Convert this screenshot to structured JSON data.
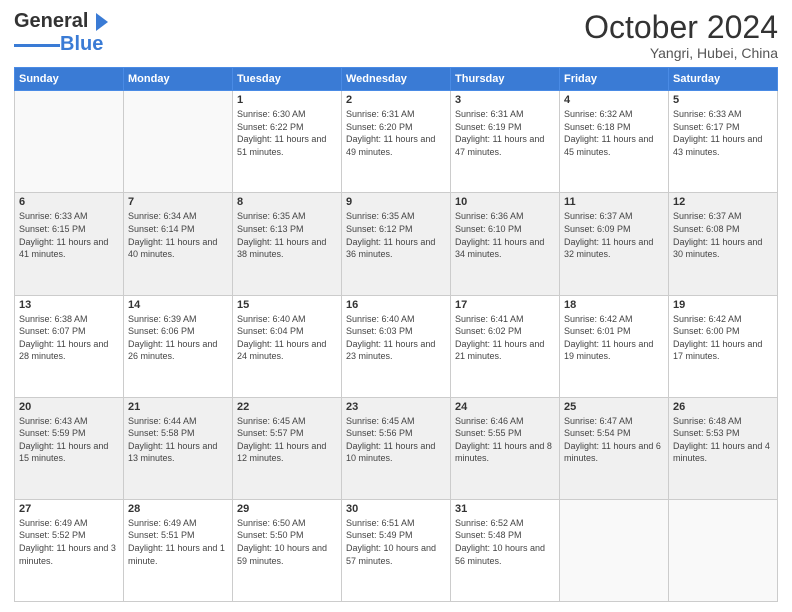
{
  "header": {
    "logo_general": "General",
    "logo_blue": "Blue",
    "month_title": "October 2024",
    "location": "Yangri, Hubei, China"
  },
  "days_of_week": [
    "Sunday",
    "Monday",
    "Tuesday",
    "Wednesday",
    "Thursday",
    "Friday",
    "Saturday"
  ],
  "weeks": [
    [
      {
        "day": "",
        "sunrise": "",
        "sunset": "",
        "daylight": "",
        "empty": true
      },
      {
        "day": "",
        "sunrise": "",
        "sunset": "",
        "daylight": "",
        "empty": true
      },
      {
        "day": "1",
        "sunrise": "Sunrise: 6:30 AM",
        "sunset": "Sunset: 6:22 PM",
        "daylight": "Daylight: 11 hours and 51 minutes.",
        "empty": false
      },
      {
        "day": "2",
        "sunrise": "Sunrise: 6:31 AM",
        "sunset": "Sunset: 6:20 PM",
        "daylight": "Daylight: 11 hours and 49 minutes.",
        "empty": false
      },
      {
        "day": "3",
        "sunrise": "Sunrise: 6:31 AM",
        "sunset": "Sunset: 6:19 PM",
        "daylight": "Daylight: 11 hours and 47 minutes.",
        "empty": false
      },
      {
        "day": "4",
        "sunrise": "Sunrise: 6:32 AM",
        "sunset": "Sunset: 6:18 PM",
        "daylight": "Daylight: 11 hours and 45 minutes.",
        "empty": false
      },
      {
        "day": "5",
        "sunrise": "Sunrise: 6:33 AM",
        "sunset": "Sunset: 6:17 PM",
        "daylight": "Daylight: 11 hours and 43 minutes.",
        "empty": false
      }
    ],
    [
      {
        "day": "6",
        "sunrise": "Sunrise: 6:33 AM",
        "sunset": "Sunset: 6:15 PM",
        "daylight": "Daylight: 11 hours and 41 minutes.",
        "empty": false
      },
      {
        "day": "7",
        "sunrise": "Sunrise: 6:34 AM",
        "sunset": "Sunset: 6:14 PM",
        "daylight": "Daylight: 11 hours and 40 minutes.",
        "empty": false
      },
      {
        "day": "8",
        "sunrise": "Sunrise: 6:35 AM",
        "sunset": "Sunset: 6:13 PM",
        "daylight": "Daylight: 11 hours and 38 minutes.",
        "empty": false
      },
      {
        "day": "9",
        "sunrise": "Sunrise: 6:35 AM",
        "sunset": "Sunset: 6:12 PM",
        "daylight": "Daylight: 11 hours and 36 minutes.",
        "empty": false
      },
      {
        "day": "10",
        "sunrise": "Sunrise: 6:36 AM",
        "sunset": "Sunset: 6:10 PM",
        "daylight": "Daylight: 11 hours and 34 minutes.",
        "empty": false
      },
      {
        "day": "11",
        "sunrise": "Sunrise: 6:37 AM",
        "sunset": "Sunset: 6:09 PM",
        "daylight": "Daylight: 11 hours and 32 minutes.",
        "empty": false
      },
      {
        "day": "12",
        "sunrise": "Sunrise: 6:37 AM",
        "sunset": "Sunset: 6:08 PM",
        "daylight": "Daylight: 11 hours and 30 minutes.",
        "empty": false
      }
    ],
    [
      {
        "day": "13",
        "sunrise": "Sunrise: 6:38 AM",
        "sunset": "Sunset: 6:07 PM",
        "daylight": "Daylight: 11 hours and 28 minutes.",
        "empty": false
      },
      {
        "day": "14",
        "sunrise": "Sunrise: 6:39 AM",
        "sunset": "Sunset: 6:06 PM",
        "daylight": "Daylight: 11 hours and 26 minutes.",
        "empty": false
      },
      {
        "day": "15",
        "sunrise": "Sunrise: 6:40 AM",
        "sunset": "Sunset: 6:04 PM",
        "daylight": "Daylight: 11 hours and 24 minutes.",
        "empty": false
      },
      {
        "day": "16",
        "sunrise": "Sunrise: 6:40 AM",
        "sunset": "Sunset: 6:03 PM",
        "daylight": "Daylight: 11 hours and 23 minutes.",
        "empty": false
      },
      {
        "day": "17",
        "sunrise": "Sunrise: 6:41 AM",
        "sunset": "Sunset: 6:02 PM",
        "daylight": "Daylight: 11 hours and 21 minutes.",
        "empty": false
      },
      {
        "day": "18",
        "sunrise": "Sunrise: 6:42 AM",
        "sunset": "Sunset: 6:01 PM",
        "daylight": "Daylight: 11 hours and 19 minutes.",
        "empty": false
      },
      {
        "day": "19",
        "sunrise": "Sunrise: 6:42 AM",
        "sunset": "Sunset: 6:00 PM",
        "daylight": "Daylight: 11 hours and 17 minutes.",
        "empty": false
      }
    ],
    [
      {
        "day": "20",
        "sunrise": "Sunrise: 6:43 AM",
        "sunset": "Sunset: 5:59 PM",
        "daylight": "Daylight: 11 hours and 15 minutes.",
        "empty": false
      },
      {
        "day": "21",
        "sunrise": "Sunrise: 6:44 AM",
        "sunset": "Sunset: 5:58 PM",
        "daylight": "Daylight: 11 hours and 13 minutes.",
        "empty": false
      },
      {
        "day": "22",
        "sunrise": "Sunrise: 6:45 AM",
        "sunset": "Sunset: 5:57 PM",
        "daylight": "Daylight: 11 hours and 12 minutes.",
        "empty": false
      },
      {
        "day": "23",
        "sunrise": "Sunrise: 6:45 AM",
        "sunset": "Sunset: 5:56 PM",
        "daylight": "Daylight: 11 hours and 10 minutes.",
        "empty": false
      },
      {
        "day": "24",
        "sunrise": "Sunrise: 6:46 AM",
        "sunset": "Sunset: 5:55 PM",
        "daylight": "Daylight: 11 hours and 8 minutes.",
        "empty": false
      },
      {
        "day": "25",
        "sunrise": "Sunrise: 6:47 AM",
        "sunset": "Sunset: 5:54 PM",
        "daylight": "Daylight: 11 hours and 6 minutes.",
        "empty": false
      },
      {
        "day": "26",
        "sunrise": "Sunrise: 6:48 AM",
        "sunset": "Sunset: 5:53 PM",
        "daylight": "Daylight: 11 hours and 4 minutes.",
        "empty": false
      }
    ],
    [
      {
        "day": "27",
        "sunrise": "Sunrise: 6:49 AM",
        "sunset": "Sunset: 5:52 PM",
        "daylight": "Daylight: 11 hours and 3 minutes.",
        "empty": false
      },
      {
        "day": "28",
        "sunrise": "Sunrise: 6:49 AM",
        "sunset": "Sunset: 5:51 PM",
        "daylight": "Daylight: 11 hours and 1 minute.",
        "empty": false
      },
      {
        "day": "29",
        "sunrise": "Sunrise: 6:50 AM",
        "sunset": "Sunset: 5:50 PM",
        "daylight": "Daylight: 10 hours and 59 minutes.",
        "empty": false
      },
      {
        "day": "30",
        "sunrise": "Sunrise: 6:51 AM",
        "sunset": "Sunset: 5:49 PM",
        "daylight": "Daylight: 10 hours and 57 minutes.",
        "empty": false
      },
      {
        "day": "31",
        "sunrise": "Sunrise: 6:52 AM",
        "sunset": "Sunset: 5:48 PM",
        "daylight": "Daylight: 10 hours and 56 minutes.",
        "empty": false
      },
      {
        "day": "",
        "sunrise": "",
        "sunset": "",
        "daylight": "",
        "empty": true
      },
      {
        "day": "",
        "sunrise": "",
        "sunset": "",
        "daylight": "",
        "empty": true
      }
    ]
  ]
}
